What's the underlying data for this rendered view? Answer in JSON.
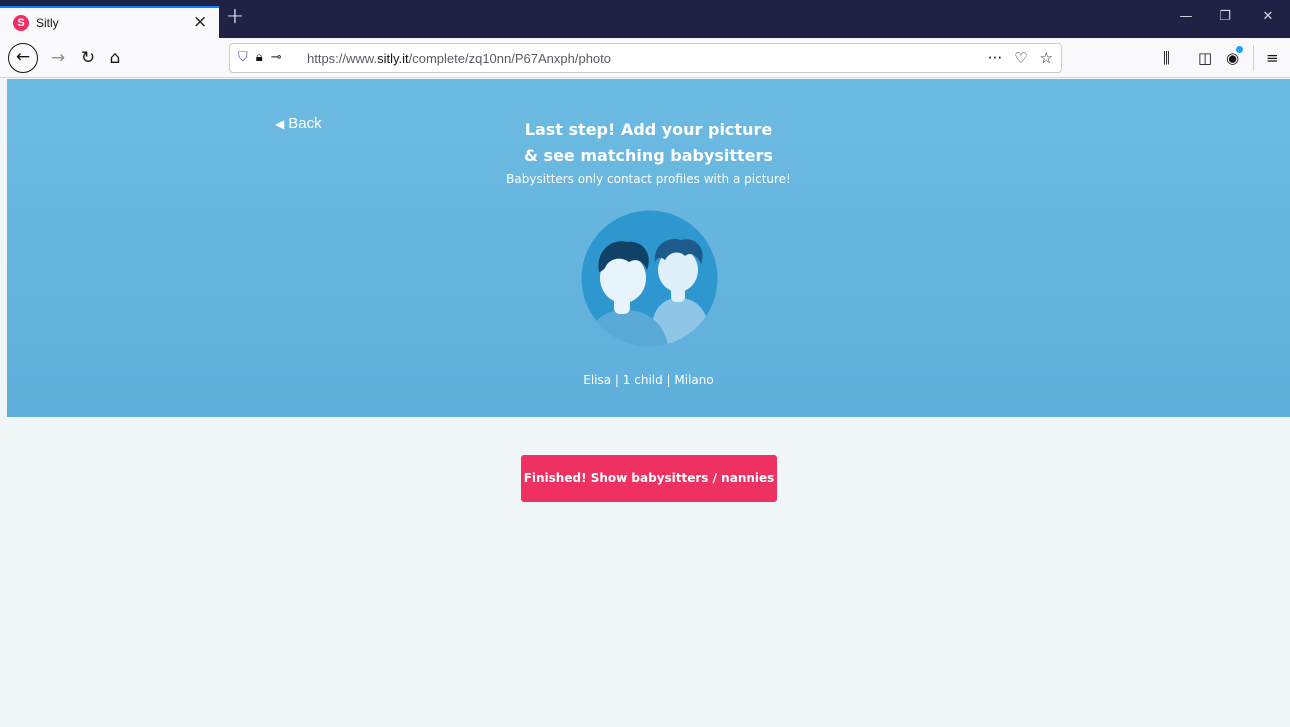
{
  "browser": {
    "tab_title": "Sitly",
    "tab_favicon_letter": "S",
    "tab_close": "×",
    "new_tab": "+",
    "url_scheme": "https://www.",
    "url_host": "sitly.it",
    "url_path": "/complete/zq10nn/P67Anxph/photo",
    "colors": {
      "tabbar": "#1f2245",
      "accent": "#0a84ff",
      "favicon": "#ef2d5e"
    }
  },
  "page": {
    "back_label": "Back",
    "title_line1": "Last step! Add your picture",
    "title_line2": "& see matching babysitters",
    "subtitle": "Babysitters only contact profiles with a picture!",
    "profile_summary": "Elisa | 1 child | Milano",
    "finish_button": "Finished! Show babysitters / nannies",
    "colors": {
      "hero": "#62b3de",
      "button": "#ef3161",
      "background": "#f1f6f9"
    }
  }
}
